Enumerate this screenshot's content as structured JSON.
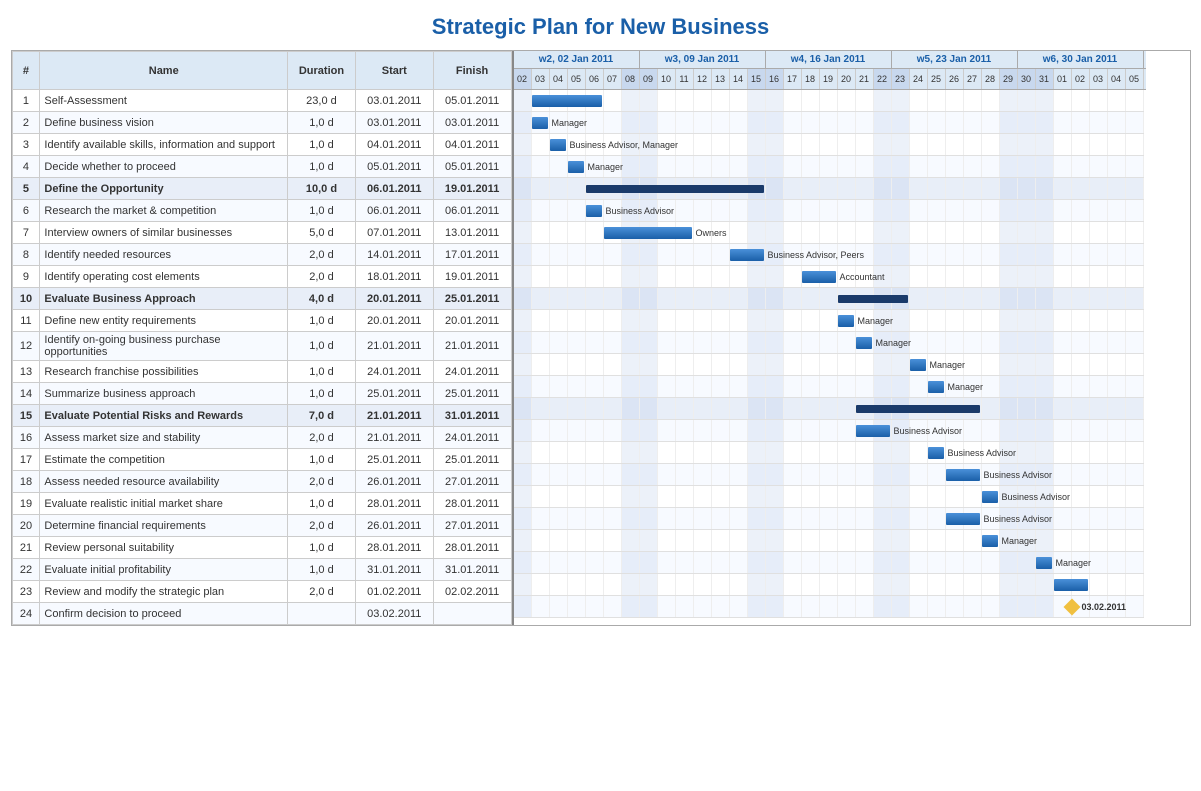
{
  "title": "Strategic Plan for New Business",
  "table": {
    "headers": [
      "#",
      "Name",
      "Duration",
      "Start",
      "Finish"
    ],
    "rows": [
      {
        "id": 1,
        "name": "Self-Assessment",
        "dur": "23,0 d",
        "start": "03.01.2011",
        "finish": "05.01.2011",
        "summary": false
      },
      {
        "id": 2,
        "name": "Define business vision",
        "dur": "1,0 d",
        "start": "03.01.2011",
        "finish": "03.01.2011",
        "summary": false
      },
      {
        "id": 3,
        "name": "Identify available skills, information and support",
        "dur": "1,0 d",
        "start": "04.01.2011",
        "finish": "04.01.2011",
        "summary": false
      },
      {
        "id": 4,
        "name": "Decide whether to proceed",
        "dur": "1,0 d",
        "start": "05.01.2011",
        "finish": "05.01.2011",
        "summary": false
      },
      {
        "id": 5,
        "name": "Define the Opportunity",
        "dur": "10,0 d",
        "start": "06.01.2011",
        "finish": "19.01.2011",
        "summary": true
      },
      {
        "id": 6,
        "name": "Research the market & competition",
        "dur": "1,0 d",
        "start": "06.01.2011",
        "finish": "06.01.2011",
        "summary": false
      },
      {
        "id": 7,
        "name": "Interview owners of similar businesses",
        "dur": "5,0 d",
        "start": "07.01.2011",
        "finish": "13.01.2011",
        "summary": false
      },
      {
        "id": 8,
        "name": "Identify needed resources",
        "dur": "2,0 d",
        "start": "14.01.2011",
        "finish": "17.01.2011",
        "summary": false
      },
      {
        "id": 9,
        "name": "Identify operating cost elements",
        "dur": "2,0 d",
        "start": "18.01.2011",
        "finish": "19.01.2011",
        "summary": false
      },
      {
        "id": 10,
        "name": "Evaluate Business Approach",
        "dur": "4,0 d",
        "start": "20.01.2011",
        "finish": "25.01.2011",
        "summary": true
      },
      {
        "id": 11,
        "name": "Define new entity requirements",
        "dur": "1,0 d",
        "start": "20.01.2011",
        "finish": "20.01.2011",
        "summary": false
      },
      {
        "id": 12,
        "name": "Identify on-going business purchase opportunities",
        "dur": "1,0 d",
        "start": "21.01.2011",
        "finish": "21.01.2011",
        "summary": false
      },
      {
        "id": 13,
        "name": "Research franchise possibilities",
        "dur": "1,0 d",
        "start": "24.01.2011",
        "finish": "24.01.2011",
        "summary": false
      },
      {
        "id": 14,
        "name": "Summarize business approach",
        "dur": "1,0 d",
        "start": "25.01.2011",
        "finish": "25.01.2011",
        "summary": false
      },
      {
        "id": 15,
        "name": "Evaluate Potential Risks and Rewards",
        "dur": "7,0 d",
        "start": "21.01.2011",
        "finish": "31.01.2011",
        "summary": true
      },
      {
        "id": 16,
        "name": "Assess market size and stability",
        "dur": "2,0 d",
        "start": "21.01.2011",
        "finish": "24.01.2011",
        "summary": false
      },
      {
        "id": 17,
        "name": "Estimate the competition",
        "dur": "1,0 d",
        "start": "25.01.2011",
        "finish": "25.01.2011",
        "summary": false
      },
      {
        "id": 18,
        "name": "Assess needed resource availability",
        "dur": "2,0 d",
        "start": "26.01.2011",
        "finish": "27.01.2011",
        "summary": false
      },
      {
        "id": 19,
        "name": "Evaluate realistic initial market share",
        "dur": "1,0 d",
        "start": "28.01.2011",
        "finish": "28.01.2011",
        "summary": false
      },
      {
        "id": 20,
        "name": "Determine financial requirements",
        "dur": "2,0 d",
        "start": "26.01.2011",
        "finish": "27.01.2011",
        "summary": false
      },
      {
        "id": 21,
        "name": "Review personal suitability",
        "dur": "1,0 d",
        "start": "28.01.2011",
        "finish": "28.01.2011",
        "summary": false
      },
      {
        "id": 22,
        "name": "Evaluate initial profitability",
        "dur": "1,0 d",
        "start": "31.01.2011",
        "finish": "31.01.2011",
        "summary": false
      },
      {
        "id": 23,
        "name": "Review and modify the strategic plan",
        "dur": "2,0 d",
        "start": "01.02.2011",
        "finish": "02.02.2011",
        "summary": false
      },
      {
        "id": 24,
        "name": "Confirm decision to proceed",
        "dur": "",
        "start": "03.02.2011",
        "finish": "",
        "summary": false
      }
    ]
  },
  "gantt": {
    "weeks": [
      {
        "label": "w2, 02 Jan 2011",
        "days": 7
      },
      {
        "label": "w3, 09 Jan 2011",
        "days": 7
      },
      {
        "label": "w4, 16 Jan 2011",
        "days": 7
      },
      {
        "label": "w5, 23 Jan 2011",
        "days": 7
      },
      {
        "label": "w6, 30 Jan 2011",
        "days": 7
      }
    ],
    "days": [
      "02",
      "03",
      "04",
      "05",
      "06",
      "07",
      "08",
      "09",
      "10",
      "11",
      "12",
      "13",
      "14",
      "15",
      "16",
      "17",
      "18",
      "19",
      "20",
      "21",
      "22",
      "23",
      "24",
      "25",
      "26",
      "27",
      "28",
      "29",
      "30",
      "31",
      "01",
      "02",
      "03",
      "04",
      "05"
    ],
    "weekends": [
      0,
      6,
      7,
      13,
      14,
      20,
      21,
      27,
      28,
      29
    ],
    "bars": [
      {
        "row": 0,
        "start": 1,
        "len": 4,
        "label": "",
        "summary": false
      },
      {
        "row": 1,
        "start": 1,
        "len": 1,
        "label": "Manager",
        "summary": false
      },
      {
        "row": 2,
        "start": 2,
        "len": 1,
        "label": "Business Advisor, Manager",
        "summary": false
      },
      {
        "row": 3,
        "start": 3,
        "len": 1,
        "label": "Manager",
        "summary": false
      },
      {
        "row": 4,
        "start": 4,
        "len": 10,
        "label": "",
        "summary": true
      },
      {
        "row": 5,
        "start": 4,
        "len": 1,
        "label": "Business Advisor",
        "summary": false
      },
      {
        "row": 6,
        "start": 5,
        "len": 5,
        "label": "Owners",
        "summary": false
      },
      {
        "row": 7,
        "start": 12,
        "len": 2,
        "label": "Business Advisor, Peers",
        "summary": false
      },
      {
        "row": 8,
        "start": 16,
        "len": 2,
        "label": "Accountant",
        "summary": false
      },
      {
        "row": 9,
        "start": 18,
        "len": 4,
        "label": "",
        "summary": true
      },
      {
        "row": 10,
        "start": 18,
        "len": 1,
        "label": "Manager",
        "summary": false
      },
      {
        "row": 11,
        "start": 19,
        "len": 1,
        "label": "Manager",
        "summary": false
      },
      {
        "row": 12,
        "start": 22,
        "len": 1,
        "label": "Manager",
        "summary": false
      },
      {
        "row": 13,
        "start": 23,
        "len": 1,
        "label": "Manager",
        "summary": false
      },
      {
        "row": 14,
        "start": 19,
        "len": 7,
        "label": "",
        "summary": true
      },
      {
        "row": 15,
        "start": 19,
        "len": 2,
        "label": "Business Advisor",
        "summary": false
      },
      {
        "row": 16,
        "start": 23,
        "len": 1,
        "label": "Business Advisor",
        "summary": false
      },
      {
        "row": 17,
        "start": 24,
        "len": 2,
        "label": "Business Advisor",
        "summary": false
      },
      {
        "row": 18,
        "start": 26,
        "len": 1,
        "label": "Business Advisor",
        "summary": false
      },
      {
        "row": 19,
        "start": 24,
        "len": 2,
        "label": "Business Advisor",
        "summary": false
      },
      {
        "row": 20,
        "start": 26,
        "len": 1,
        "label": "Manager",
        "summary": false
      },
      {
        "row": 21,
        "start": 29,
        "len": 1,
        "label": "Manager",
        "summary": false
      },
      {
        "row": 22,
        "start": 30,
        "len": 2,
        "label": "",
        "summary": false
      },
      {
        "row": 23,
        "start": 31,
        "len": 0,
        "label": "03.02.2011",
        "milestone": true
      }
    ]
  }
}
